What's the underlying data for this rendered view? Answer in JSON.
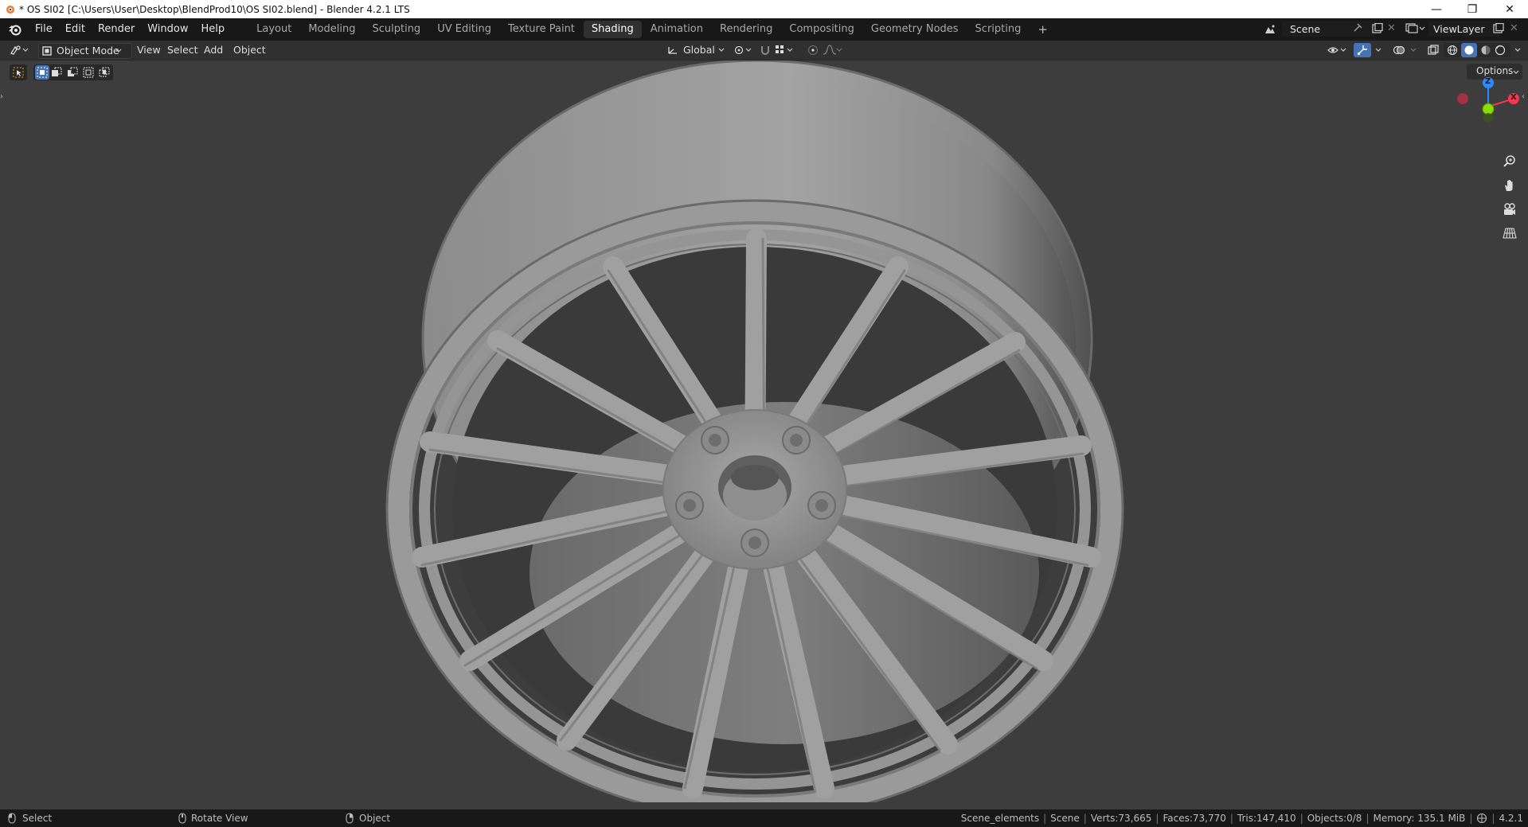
{
  "window": {
    "title": "* OS SI02 [C:\\Users\\User\\Desktop\\BlendProd10\\OS SI02.blend] - Blender 4.2.1 LTS",
    "minimize_glyph": "—",
    "restore_glyph": "❐",
    "close_glyph": "✕"
  },
  "menu": [
    "File",
    "Edit",
    "Render",
    "Window",
    "Help"
  ],
  "workspaces": {
    "tabs": [
      "Layout",
      "Modeling",
      "Sculpting",
      "UV Editing",
      "Texture Paint",
      "Shading",
      "Animation",
      "Rendering",
      "Compositing",
      "Geometry Nodes",
      "Scripting"
    ],
    "active": "Shading",
    "add_glyph": "+"
  },
  "scene": {
    "name": "Scene"
  },
  "view_layer": {
    "name": "ViewLayer"
  },
  "header": {
    "mode": "Object Mode",
    "menus": [
      "View",
      "Select",
      "Add",
      "Object"
    ],
    "transform_orientation": "Global",
    "options_label": "Options"
  },
  "gizmo": {
    "z_label": "Z",
    "x_label": "X",
    "y_label": "Y"
  },
  "statusbar": {
    "select": "Select",
    "rotate": "Rotate View",
    "object": "Object",
    "collection": "Scene_elements",
    "scene": "Scene",
    "verts": "Verts:73,665",
    "faces": "Faces:73,770",
    "tris": "Tris:147,410",
    "objects": "Objects:0/8",
    "memory": "Memory: 135.1 MiB",
    "version": "4.2.1"
  },
  "colors": {
    "accent": "#4772b3",
    "axis_x": "#ff3352",
    "axis_y": "#8bdc00",
    "axis_z": "#2b8cff",
    "viewport_bg": "#3d3d3d",
    "active_tab": "#303030"
  }
}
